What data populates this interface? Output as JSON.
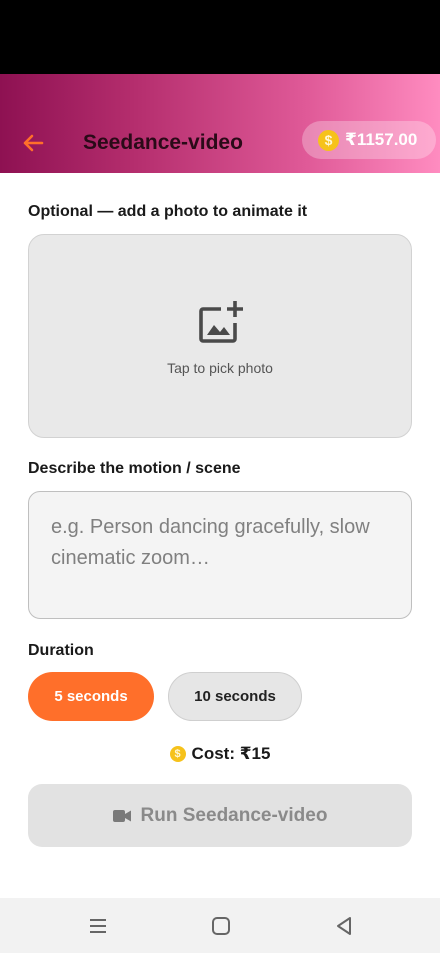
{
  "app_bar": {
    "title": "Seedance-video",
    "balance": "₹1157.00"
  },
  "photo_section": {
    "label": "Optional — add a photo to animate it",
    "hint": "Tap to pick photo"
  },
  "prompt_section": {
    "label": "Describe the motion / scene",
    "placeholder": "e.g. Person dancing gracefully, slow cinematic zoom…"
  },
  "duration": {
    "label": "Duration",
    "options": [
      "5 seconds",
      "10 seconds"
    ],
    "selected": "5 seconds"
  },
  "cost": {
    "text": "Cost: ₹15"
  },
  "run_button": {
    "label": "Run Seedance-video",
    "enabled": false
  },
  "icons": {
    "back": "arrow-left-icon",
    "coin": "coin-icon",
    "add_photo": "add-photo-icon",
    "video": "videocam-icon",
    "nav": [
      "menu-icon",
      "home-icon",
      "back-triangle-icon"
    ]
  },
  "colors": {
    "accent": "#ff6f2a",
    "coin": "#f6c21b",
    "header_start": "#8e1152",
    "header_end": "#ff8cc0"
  }
}
